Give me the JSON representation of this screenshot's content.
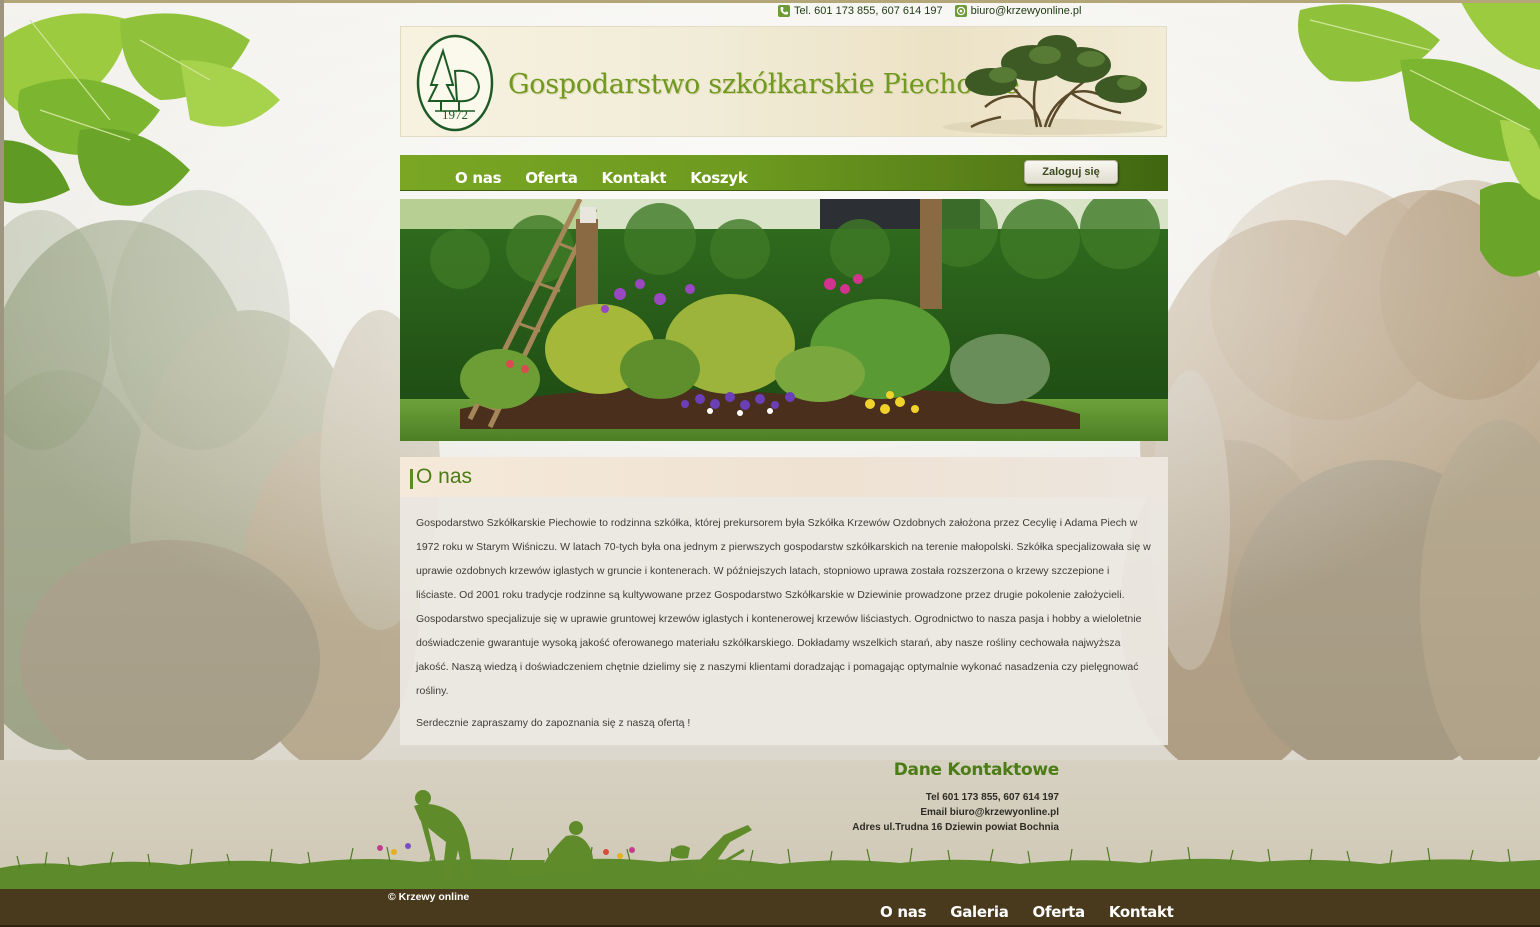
{
  "top_contact": {
    "phone": "Tel. 601 173 855, 607 614 197",
    "email": "biuro@krzewyonline.pl",
    "phone_icon": "phone-icon",
    "email_icon": "at-icon"
  },
  "header": {
    "title": "Gospodarstwo szkółkarskie Piechowie",
    "logo_year": "1972"
  },
  "nav": {
    "items": [
      {
        "label": "O nas"
      },
      {
        "label": "Oferta"
      },
      {
        "label": "Kontakt"
      },
      {
        "label": "Koszyk"
      }
    ],
    "login_label": "Zaloguj się"
  },
  "content": {
    "title": "O nas",
    "intro": "Gospodarstwo Szkółkarskie Piechowie to rodzinna szkółka, której prekursorem była Szkółka Krzewów Ozdobnych założona przez Cecylię i Adama Piech w 1972 roku w Starym Wiśniczu. W latach 70-tych była ona jednym z pierwszych gospodarstw szkółkarskich na terenie małopolski. Szkółka specjalizowała się w uprawie ozdobnych krzewów iglastych w gruncie i kontenerach. W późniejszych latach, stopniowo uprawa została rozszerzona o krzewy szczepione i liściaste. Od 2001 roku tradycje rodzinne są kultywowane przez Gospodarstwo Szkółkarskie w Dziewinie prowadzone przez drugie pokolenie założycieli. Gospodarstwo specjalizuje się w uprawie gruntowej krzewów iglastych i kontenerowej krzewów liściastych. Ogrodnictwo to nasza pasja i hobby a wieloletnie doświadczenie gwarantuje wysoką jakość oferowanego materiału szkółkarskiego. Dokładamy wszelkich starań, aby nasze rośliny cechowała najwyższa jakość. Naszą wiedzą i doświadczeniem chętnie dzielimy się z naszymi klientami doradzając i pomagając optymalnie wykonać nasadzenia czy pielęgnować rośliny.",
    "closing": "Serdecznie zapraszamy do zapoznania się z naszą ofertą !"
  },
  "footer": {
    "title": "Dane Kontaktowe",
    "lines": [
      "Tel 601 173 855, 607 614 197",
      "Email biuro@krzewyonline.pl",
      "Adres ul.Trudna 16 Dziewin powiat Bochnia"
    ],
    "copyright": "© Krzewy online",
    "nav": [
      {
        "label": "O nas"
      },
      {
        "label": "Galeria"
      },
      {
        "label": "Oferta"
      },
      {
        "label": "Kontakt"
      }
    ]
  },
  "colors": {
    "accent_green": "#6d9a1f",
    "title_green": "#4c7c15",
    "footer_brown": "#4a3a1d"
  }
}
